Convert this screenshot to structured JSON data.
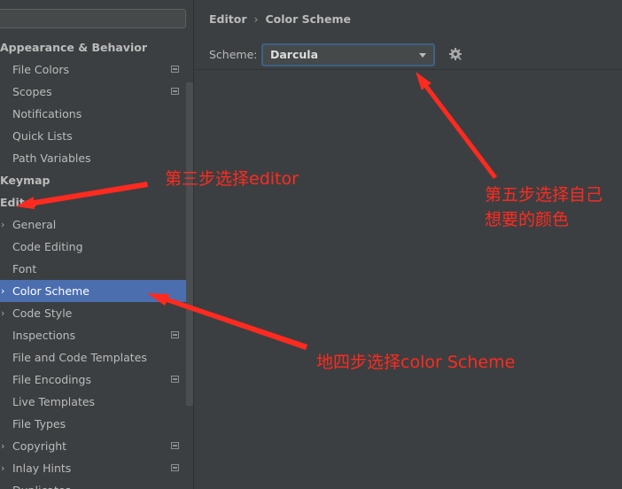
{
  "sidebar": {
    "items": [
      {
        "label": "Appearance & Behavior",
        "level": "top"
      },
      {
        "label": "File Colors",
        "level": "child",
        "project_icon": true
      },
      {
        "label": "Scopes",
        "level": "child",
        "project_icon": true
      },
      {
        "label": "Notifications",
        "level": "child"
      },
      {
        "label": "Quick Lists",
        "level": "child"
      },
      {
        "label": "Path Variables",
        "level": "child"
      },
      {
        "label": "Keymap",
        "level": "top"
      },
      {
        "label": "Editor",
        "level": "top"
      },
      {
        "label": "General",
        "level": "child",
        "expandable": true
      },
      {
        "label": "Code Editing",
        "level": "child"
      },
      {
        "label": "Font",
        "level": "child"
      },
      {
        "label": "Color Scheme",
        "level": "child",
        "expandable": true,
        "selected": true
      },
      {
        "label": "Code Style",
        "level": "child",
        "expandable": true
      },
      {
        "label": "Inspections",
        "level": "child",
        "project_icon": true
      },
      {
        "label": "File and Code Templates",
        "level": "child"
      },
      {
        "label": "File Encodings",
        "level": "child",
        "project_icon": true
      },
      {
        "label": "Live Templates",
        "level": "child"
      },
      {
        "label": "File Types",
        "level": "child"
      },
      {
        "label": "Copyright",
        "level": "child",
        "expandable": true,
        "project_icon": true
      },
      {
        "label": "Inlay Hints",
        "level": "child",
        "expandable": true,
        "project_icon": true
      },
      {
        "label": "Duplicates",
        "level": "child"
      }
    ]
  },
  "breadcrumb": {
    "parent": "Editor",
    "separator": "›",
    "current": "Color Scheme"
  },
  "scheme": {
    "label": "Scheme:",
    "value": "Darcula"
  },
  "annotations": {
    "step3": "第三步选择editor",
    "step4": "地四步选择color Scheme",
    "step5_line1": "第五步选择自己",
    "step5_line2": "想要的颜色"
  },
  "colors": {
    "selection": "#4b6eaf",
    "annotation": "#ff2a1f",
    "background": "#3c3f41"
  }
}
